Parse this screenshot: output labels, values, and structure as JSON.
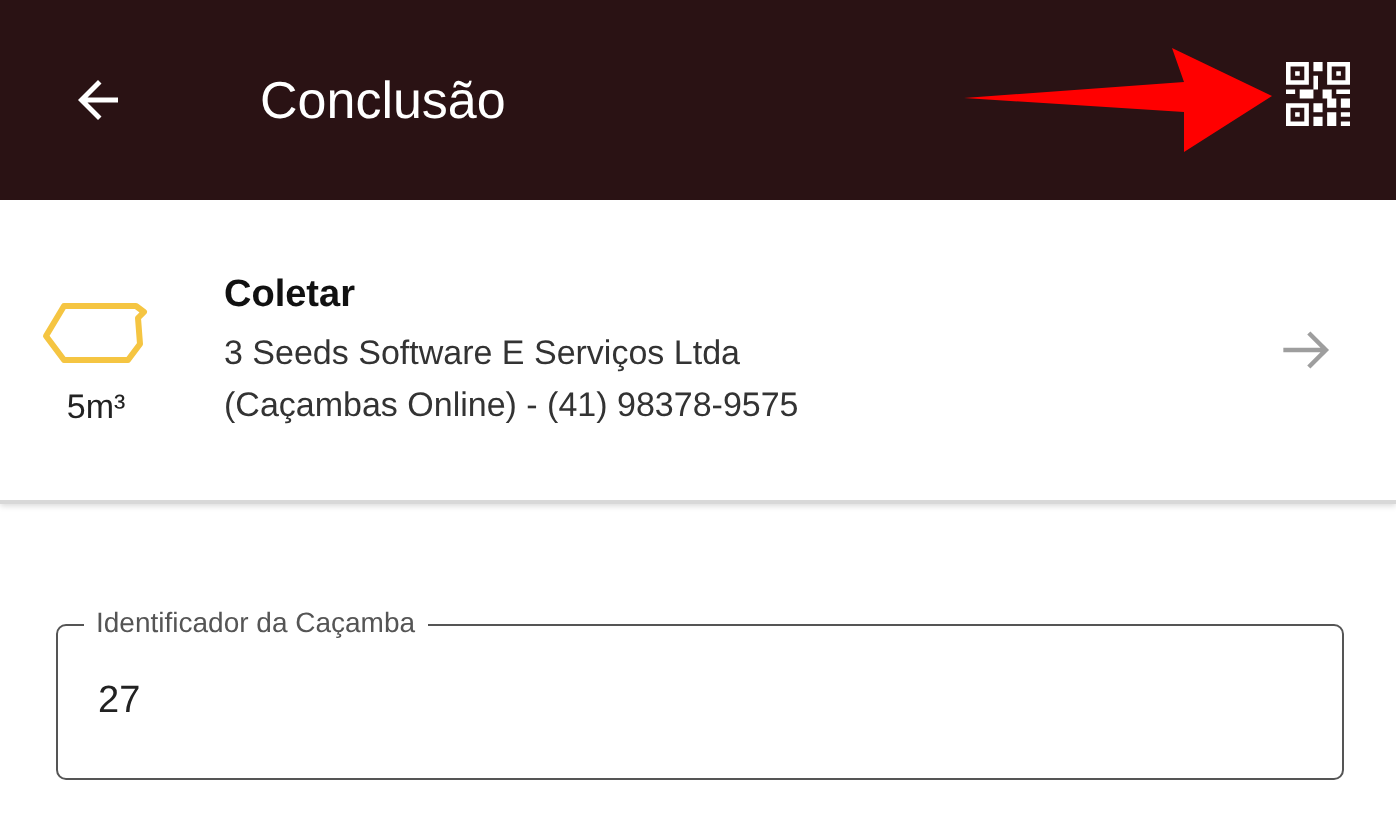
{
  "app_bar": {
    "title": "Conclusão"
  },
  "order": {
    "action": "Coletar",
    "size": "5m³",
    "customer_line_1": "3 Seeds Software E Serviços Ltda",
    "customer_line_2": "(Caçambas Online) - (41) 98378-9575"
  },
  "field": {
    "label": "Identificador da Caçamba",
    "value": "27"
  }
}
